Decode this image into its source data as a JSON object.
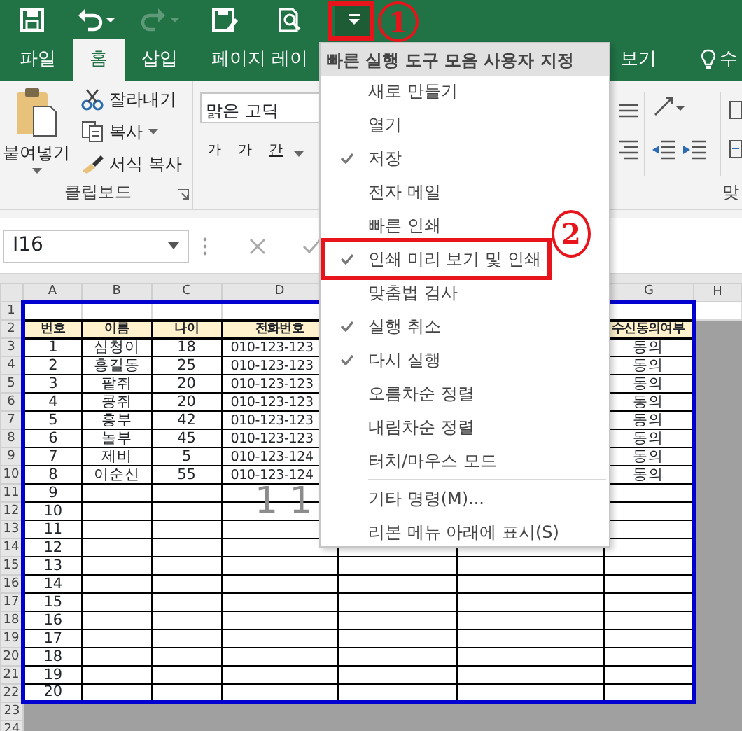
{
  "quick_access": [
    {
      "kind": "save",
      "disabled": false
    },
    {
      "kind": "undo",
      "disabled": false
    },
    {
      "kind": "redo",
      "disabled": true
    },
    {
      "kind": "print",
      "disabled": false
    },
    {
      "kind": "preview",
      "disabled": false
    },
    {
      "kind": "customize",
      "disabled": false
    }
  ],
  "tabs": [
    {
      "label": "파일",
      "selected": false
    },
    {
      "label": "홈",
      "selected": true
    },
    {
      "label": "삽입",
      "selected": false
    },
    {
      "label": "페이지 레이",
      "selected": false
    },
    {
      "label": "보기",
      "selected": false
    },
    {
      "label": "수",
      "selected": false,
      "kind": "tell"
    }
  ],
  "ribbon": {
    "clipboard": {
      "paste": "붙여넣기",
      "cut": "잘라내기",
      "copy": "복사",
      "format_painter": "서식 복사",
      "group_label": "클립보드"
    },
    "font": {
      "font_name": "맑은 고딕",
      "bold": "가",
      "italic": "가",
      "underline": "간"
    },
    "alignment": {
      "group_label": "맞"
    }
  },
  "formula_bar": {
    "name_box": "I16"
  },
  "sheet": {
    "columns": [
      {
        "label": "A"
      },
      {
        "label": "B"
      },
      {
        "label": "C"
      },
      {
        "label": "D"
      },
      {
        "label": "G"
      },
      {
        "label": "H"
      }
    ],
    "row_numbers": [
      "1",
      "2",
      "3",
      "4",
      "5",
      "6",
      "7",
      "8",
      "9",
      "10",
      "11",
      "12",
      "13",
      "14",
      "15",
      "16",
      "17",
      "18",
      "19",
      "20",
      "21",
      "22",
      "23",
      "24"
    ],
    "header": {
      "no": "번호",
      "name": "이름",
      "age": "나이",
      "phone": "전화번호",
      "consent": "수신동의여부"
    },
    "records": [
      {
        "no": "1",
        "name": "심청이",
        "age": "18",
        "phone": "010-123-123",
        "consent": "동의"
      },
      {
        "no": "2",
        "name": "홍길동",
        "age": "25",
        "phone": "010-123-123",
        "consent": "동의"
      },
      {
        "no": "3",
        "name": "팥쥐",
        "age": "20",
        "phone": "010-123-123",
        "consent": "동의"
      },
      {
        "no": "4",
        "name": "콩쥐",
        "age": "20",
        "phone": "010-123-123",
        "consent": "동의"
      },
      {
        "no": "5",
        "name": "흥부",
        "age": "42",
        "phone": "010-123-123",
        "consent": "동의"
      },
      {
        "no": "6",
        "name": "놀부",
        "age": "45",
        "phone": "010-123-123",
        "consent": "동의"
      },
      {
        "no": "7",
        "name": "제비",
        "age": "5",
        "phone": "010-123-124",
        "consent": "동의"
      },
      {
        "no": "8",
        "name": "이순신",
        "age": "55",
        "phone": "010-123-124",
        "consent": "동의"
      },
      {
        "no": "9"
      },
      {
        "no": "10"
      },
      {
        "no": "11"
      },
      {
        "no": "12"
      },
      {
        "no": "13"
      },
      {
        "no": "14"
      },
      {
        "no": "15"
      },
      {
        "no": "16"
      },
      {
        "no": "17"
      },
      {
        "no": "18"
      },
      {
        "no": "19"
      },
      {
        "no": "20"
      }
    ],
    "page_label": "1 1"
  },
  "menu": {
    "title": "빠른 실행 도구 모음 사용자 지정",
    "items": [
      {
        "kind": "command",
        "label": "새로 만들기",
        "checked": false
      },
      {
        "kind": "command",
        "label": "열기",
        "checked": false
      },
      {
        "kind": "command",
        "label": "저장",
        "checked": true
      },
      {
        "kind": "command",
        "label": "전자 메일",
        "checked": false
      },
      {
        "kind": "command",
        "label": "빠른 인쇄",
        "checked": false
      },
      {
        "kind": "command",
        "label": "인쇄 미리 보기 및 인쇄",
        "checked": true
      },
      {
        "kind": "command",
        "label": "맞춤법 검사",
        "checked": false
      },
      {
        "kind": "command",
        "label": "실행 취소",
        "checked": true
      },
      {
        "kind": "command",
        "label": "다시 실행",
        "checked": true
      },
      {
        "kind": "command",
        "label": "오름차순 정렬",
        "checked": false
      },
      {
        "kind": "command",
        "label": "내림차순 정렬",
        "checked": false
      },
      {
        "kind": "command",
        "label": "터치/마우스 모드",
        "checked": false
      },
      {
        "kind": "separator"
      },
      {
        "kind": "command",
        "label": "기타 명령(M)...",
        "checked": false
      },
      {
        "kind": "command",
        "label": "리본 메뉴 아래에 표시(S)",
        "checked": false
      }
    ]
  },
  "annotations": [
    {
      "label": "1"
    },
    {
      "label": "2"
    }
  ]
}
